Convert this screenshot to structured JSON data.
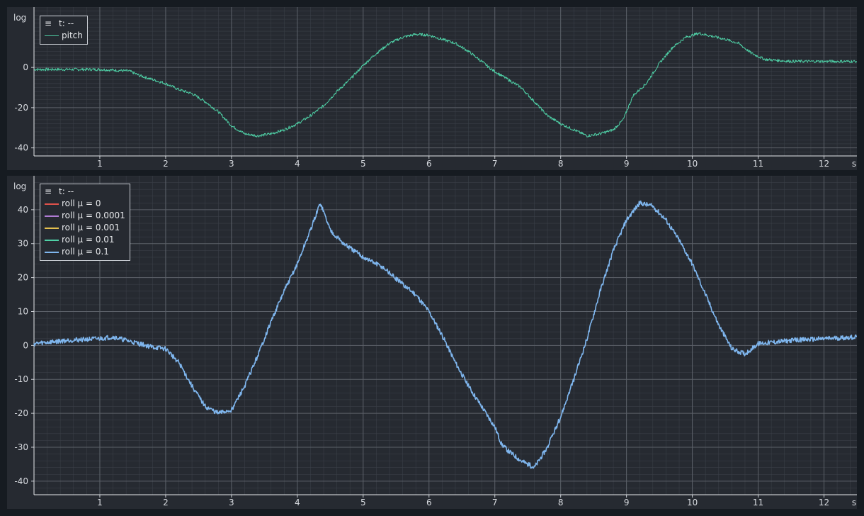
{
  "chart_data": [
    {
      "type": "line",
      "title": "",
      "ylabel": "log",
      "xlabel": "s",
      "xlim": [
        0,
        12.5
      ],
      "ylim": [
        -44,
        30
      ],
      "xticks": [
        1,
        2,
        3,
        4,
        5,
        6,
        7,
        8,
        9,
        10,
        11,
        12
      ],
      "yticks": [
        0,
        -20,
        -40
      ],
      "grid": true,
      "legend_position": "top-left",
      "legend_header": "t: --",
      "series": [
        {
          "name": "pitch",
          "color": "#4fd0a6",
          "points": [
            [
              0,
              -1
            ],
            [
              0.5,
              -1
            ],
            [
              1.0,
              -1
            ],
            [
              1.3,
              -1.5
            ],
            [
              1.45,
              -1.8
            ],
            [
              1.6,
              -4
            ],
            [
              1.8,
              -6
            ],
            [
              2.0,
              -8
            ],
            [
              2.2,
              -11
            ],
            [
              2.4,
              -13
            ],
            [
              2.6,
              -17
            ],
            [
              2.8,
              -22
            ],
            [
              3.0,
              -29
            ],
            [
              3.2,
              -33
            ],
            [
              3.4,
              -34
            ],
            [
              3.6,
              -33
            ],
            [
              3.8,
              -31
            ],
            [
              4.0,
              -28
            ],
            [
              4.2,
              -24
            ],
            [
              4.4,
              -19
            ],
            [
              4.6,
              -12
            ],
            [
              4.8,
              -6
            ],
            [
              5.0,
              1
            ],
            [
              5.2,
              7
            ],
            [
              5.4,
              12
            ],
            [
              5.6,
              15
            ],
            [
              5.8,
              16.5
            ],
            [
              6.0,
              16
            ],
            [
              6.2,
              14
            ],
            [
              6.4,
              12
            ],
            [
              6.6,
              8
            ],
            [
              6.8,
              3
            ],
            [
              6.95,
              -1
            ],
            [
              7.05,
              -3
            ],
            [
              7.2,
              -6
            ],
            [
              7.4,
              -10
            ],
            [
              7.6,
              -17
            ],
            [
              7.8,
              -24
            ],
            [
              8.0,
              -28
            ],
            [
              8.2,
              -31
            ],
            [
              8.4,
              -34
            ],
            [
              8.6,
              -33
            ],
            [
              8.8,
              -31
            ],
            [
              8.95,
              -26
            ],
            [
              9.1,
              -14
            ],
            [
              9.3,
              -8
            ],
            [
              9.5,
              2
            ],
            [
              9.7,
              10
            ],
            [
              9.9,
              15
            ],
            [
              10.1,
              17
            ],
            [
              10.3,
              15.5
            ],
            [
              10.5,
              14
            ],
            [
              10.7,
              12
            ],
            [
              10.9,
              7
            ],
            [
              11.1,
              4
            ],
            [
              11.5,
              3
            ],
            [
              12.0,
              3
            ],
            [
              12.5,
              3
            ]
          ]
        }
      ]
    },
    {
      "type": "line",
      "title": "",
      "ylabel": "log",
      "xlabel": "s",
      "xlim": [
        0,
        12.5
      ],
      "ylim": [
        -44,
        50
      ],
      "xticks": [
        1,
        2,
        3,
        4,
        5,
        6,
        7,
        8,
        9,
        10,
        11,
        12
      ],
      "yticks": [
        40,
        30,
        20,
        10,
        0,
        -10,
        -20,
        -30,
        -40
      ],
      "grid": true,
      "legend_position": "top-left",
      "legend_header": "t: --",
      "series": [
        {
          "name": "roll μ = 0",
          "color": "#e0524b"
        },
        {
          "name": "roll μ = 0.0001",
          "color": "#b07cd4"
        },
        {
          "name": "roll μ = 0.001",
          "color": "#e3c04f"
        },
        {
          "name": "roll μ = 0.01",
          "color": "#4fd0a6"
        },
        {
          "name": "roll μ = 0.1",
          "color": "#7fb6ee",
          "points": [
            [
              0,
              0.5
            ],
            [
              0.5,
              1.5
            ],
            [
              1.0,
              2
            ],
            [
              1.2,
              2.5
            ],
            [
              1.5,
              1
            ],
            [
              1.8,
              -0.5
            ],
            [
              2.0,
              -1
            ],
            [
              2.2,
              -5
            ],
            [
              2.4,
              -12
            ],
            [
              2.6,
              -18
            ],
            [
              2.8,
              -20
            ],
            [
              3.0,
              -19
            ],
            [
              3.2,
              -12
            ],
            [
              3.4,
              -3
            ],
            [
              3.6,
              7
            ],
            [
              3.8,
              16
            ],
            [
              4.0,
              24
            ],
            [
              4.2,
              34
            ],
            [
              4.35,
              42
            ],
            [
              4.5,
              34
            ],
            [
              4.7,
              30
            ],
            [
              5.0,
              26
            ],
            [
              5.3,
              23
            ],
            [
              5.6,
              18
            ],
            [
              5.8,
              15
            ],
            [
              6.0,
              10
            ],
            [
              6.2,
              3
            ],
            [
              6.4,
              -5
            ],
            [
              6.6,
              -12
            ],
            [
              6.8,
              -18
            ],
            [
              7.0,
              -24
            ],
            [
              7.1,
              -29
            ],
            [
              7.2,
              -31
            ],
            [
              7.4,
              -34
            ],
            [
              7.6,
              -36
            ],
            [
              7.8,
              -30
            ],
            [
              8.0,
              -21
            ],
            [
              8.2,
              -10
            ],
            [
              8.4,
              2
            ],
            [
              8.6,
              16
            ],
            [
              8.8,
              28
            ],
            [
              9.0,
              37
            ],
            [
              9.2,
              42
            ],
            [
              9.4,
              41
            ],
            [
              9.6,
              37
            ],
            [
              9.8,
              31
            ],
            [
              10.0,
              24
            ],
            [
              10.2,
              15
            ],
            [
              10.4,
              6
            ],
            [
              10.6,
              -1
            ],
            [
              10.8,
              -2.5
            ],
            [
              11.0,
              0.5
            ],
            [
              11.5,
              1.5
            ],
            [
              12.0,
              2
            ],
            [
              12.5,
              2.5
            ]
          ]
        }
      ]
    }
  ]
}
